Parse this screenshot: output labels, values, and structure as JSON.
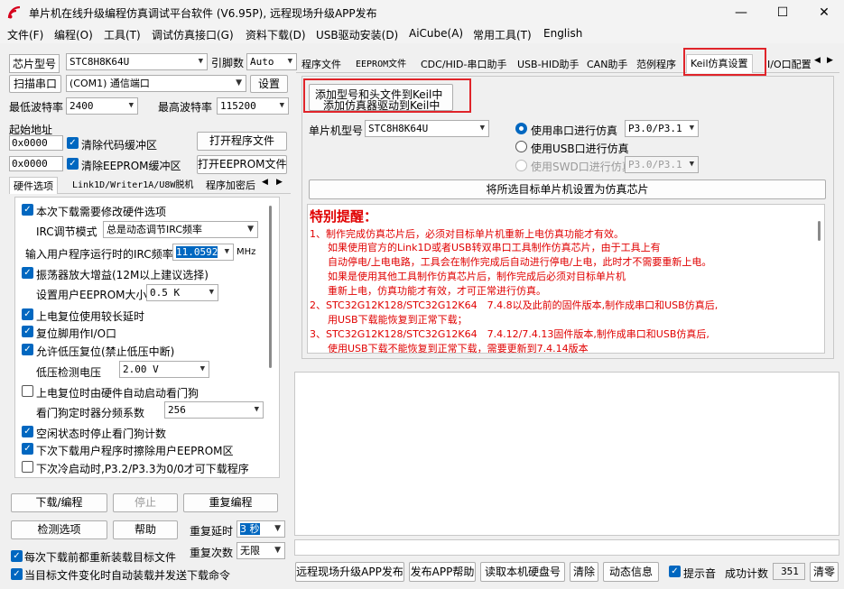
{
  "window": {
    "title": "单片机在线升级编程仿真调试平台软件 (V6.95P), 远程现场升级APP发布",
    "minimize": "—",
    "maximize": "☐",
    "close": "✕"
  },
  "menu": [
    "文件(F)",
    "编程(O)",
    "工具(T)",
    "调试仿真接口(G)",
    "资料下载(D)",
    "USB驱动安装(D)",
    "AiCube(A)",
    "常用工具(T)",
    "English"
  ],
  "left": {
    "chip_label": "芯片型号",
    "chip_value": "STC8H8K64U",
    "pins_label": "引脚数",
    "pins_value": "Auto",
    "scan_button": "扫描串口",
    "port_value": "(COM1) 通信端口",
    "settings_button": "设置",
    "min_baud_label": "最低波特率",
    "min_baud_value": "2400",
    "max_baud_label": "最高波特率",
    "max_baud_value": "115200",
    "start_addr_label": "起始地址",
    "code_addr": "0x0000",
    "clear_code_label": "清除代码缓冲区",
    "open_prog_button": "打开程序文件",
    "eeprom_addr": "0x0000",
    "clear_eeprom_label": "清除EEPROM缓冲区",
    "open_eeprom_button": "打开EEPROM文件",
    "tabs": [
      "硬件选项",
      "Link1D/Writer1A/U8W脱机",
      "程序加密后"
    ],
    "hw": {
      "opt1": "本次下载需要修改硬件选项",
      "irc_mode_label": "IRC调节模式",
      "irc_mode_value": "总是动态调节IRC频率",
      "irc_freq_label": "输入用户程序运行时的IRC频率",
      "irc_freq_value": "11.0592",
      "irc_unit": "MHz",
      "opt2": "振荡器放大增益(12M以上建议选择)",
      "eeprom_size_label": "设置用户EEPROM大小",
      "eeprom_size_value": "0.5 K",
      "opt3": "上电复位使用较长延时",
      "opt4": "复位脚用作I/O口",
      "opt5": "允许低压复位(禁止低压中断)",
      "lv_label": "低压检测电压",
      "lv_value": "2.00 V",
      "opt6": "上电复位时由硬件自动启动看门狗",
      "wdt_label": "看门狗定时器分频系数",
      "wdt_value": "256",
      "opt7": "空闲状态时停止看门狗计数",
      "opt8": "下次下载用户程序时擦除用户EEPROM区",
      "opt9": "下次冷启动时,P3.2/P3.3为0/0才可下载程序"
    },
    "download_button": "下载/编程",
    "stop_button": "停止",
    "reprogram_button": "重复编程",
    "check_button": "检测选项",
    "help_button": "帮助",
    "repeat_delay_label": "重复延时",
    "repeat_delay_value": "3 秒",
    "repeat_count_label": "重复次数",
    "repeat_count_value": "无限",
    "reload_label": "每次下载前都重新装载目标文件",
    "auto_label": "当目标文件变化时自动装载并发送下载命令"
  },
  "right": {
    "tabs": [
      "程序文件",
      "EEPROM文件",
      "CDC/HID-串口助手",
      "USB-HID助手",
      "CAN助手",
      "范例程序",
      "Keil仿真设置",
      "I/O口配置"
    ],
    "add_line1": "添加型号和头文件到Keil中",
    "add_line2": "添加仿真器驱动到Keil中",
    "mcu_label": "单片机型号",
    "mcu_value": "STC8H8K64U",
    "radio_serial": "使用串口进行仿真",
    "serial_port": "P3.0/P3.1",
    "radio_usb": "使用USB口进行仿真",
    "radio_swd": "使用SWD口进行仿真",
    "swd_port": "P3.0/P3.1",
    "set_chip_button": "将所选目标单片机设置为仿真芯片",
    "notice_title": "特别提醒：",
    "notice": [
      "1、制作完成仿真芯片后，必须对目标单片机重新上电仿真功能才有效。",
      "如果使用官方的Link1D或者USB转双串口工具制作仿真芯片，由于工具上有",
      "自动停电/上电电路，工具会在制作完成后自动进行停电/上电，此时才不需要重新上电。",
      "如果是使用其他工具制作仿真芯片后，制作完成后必须对目标单片机",
      "重新上电，仿真功能才有效，才可正常进行仿真。",
      "2、STC32G12K128/STC32G12K64　7.4.8以及此前的固件版本,制作成串口和USB仿真后,",
      "用USB下载能恢复到正常下载；",
      "3、STC32G12K128/STC32G12K64　7.4.12/7.4.13固件版本,制作成串口和USB仿真后,",
      "使用USB下载不能恢复到正常下载，需要更新到7.4.14版本"
    ],
    "bottom_buttons": [
      "远程现场升级APP发布",
      "发布APP帮助",
      "读取本机硬盘号",
      "清除",
      "动态信息"
    ],
    "beep_label": "提示音",
    "success_label": "成功计数",
    "success_value": "351",
    "clear_count_button": "清零"
  }
}
